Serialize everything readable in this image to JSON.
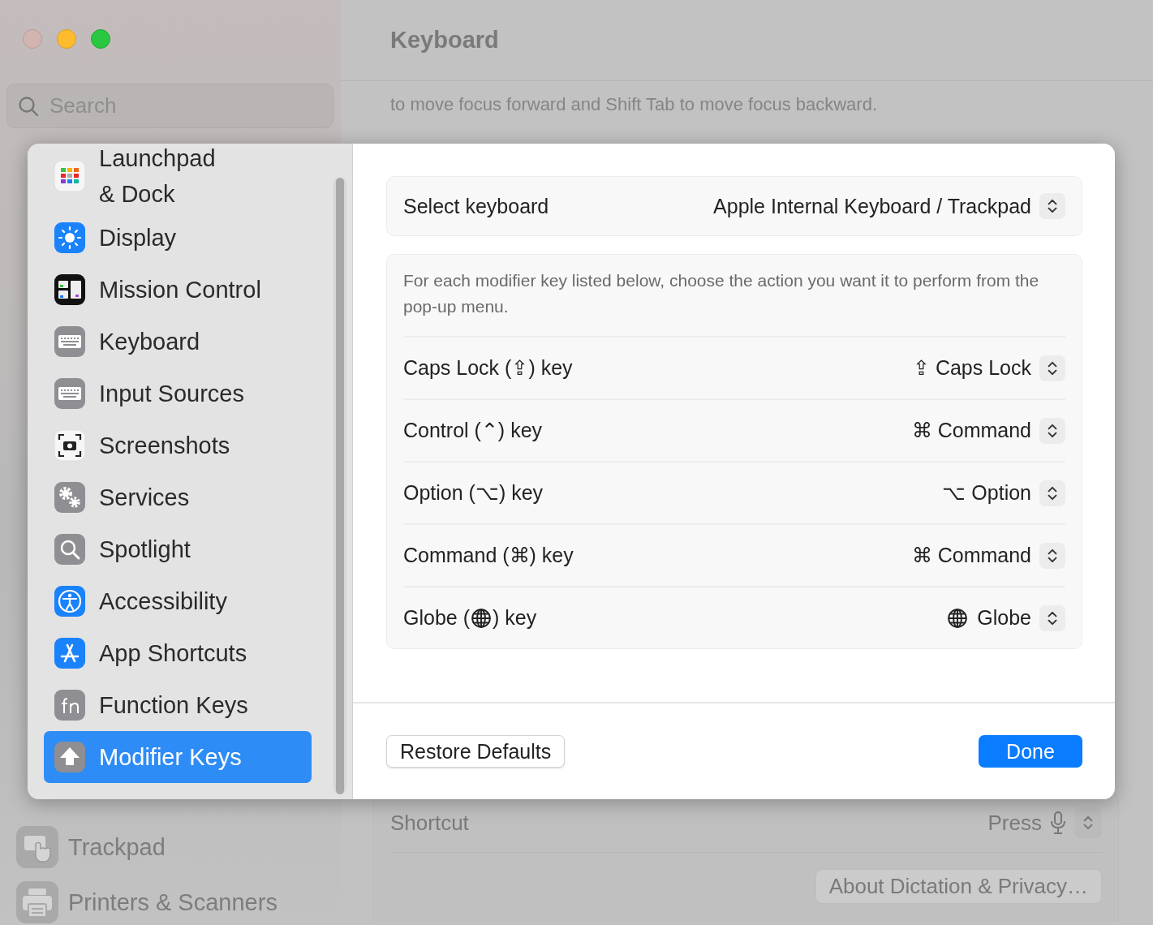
{
  "window": {
    "title": "Keyboard"
  },
  "search": {
    "placeholder": "Search"
  },
  "background_sidebar": {
    "items": [
      {
        "label": "Trackpad"
      },
      {
        "label": "Printers & Scanners"
      }
    ]
  },
  "background_pane": {
    "text": "to move focus forward and Shift Tab to move focus backward.",
    "shortcut": {
      "label": "Shortcut",
      "value": "Press"
    },
    "about_button": "About Dictation & Privacy…"
  },
  "sheet": {
    "sidebar": [
      {
        "label": "Launchpad\n& Dock",
        "selected": false
      },
      {
        "label": "Display",
        "selected": false
      },
      {
        "label": "Mission Control",
        "selected": false
      },
      {
        "label": "Keyboard",
        "selected": false
      },
      {
        "label": "Input Sources",
        "selected": false
      },
      {
        "label": "Screenshots",
        "selected": false
      },
      {
        "label": "Services",
        "selected": false
      },
      {
        "label": "Spotlight",
        "selected": false
      },
      {
        "label": "Accessibility",
        "selected": false
      },
      {
        "label": "App Shortcuts",
        "selected": false
      },
      {
        "label": "Function Keys",
        "selected": false
      },
      {
        "label": "Modifier Keys",
        "selected": true
      }
    ],
    "select_keyboard": {
      "label": "Select keyboard",
      "value": "Apple Internal Keyboard / Trackpad"
    },
    "description": "For each modifier key listed below, choose the action you want it to perform from the pop-up menu.",
    "modifiers": [
      {
        "kind": "glyph",
        "label": "Caps Lock (⇪) key",
        "value": "⇪ Caps Lock"
      },
      {
        "kind": "glyph",
        "label": "Control (⌃) key",
        "value": "⌘ Command"
      },
      {
        "kind": "glyph",
        "label": "Option (⌥) key",
        "value": "⌥ Option"
      },
      {
        "kind": "glyph",
        "label": "Command (⌘) key",
        "value": "⌘ Command"
      },
      {
        "kind": "globe",
        "label_before": "Globe (",
        "label_after": ") key",
        "value": "Globe"
      }
    ],
    "buttons": [
      {
        "kind": "plain",
        "label": "Restore Defaults"
      },
      {
        "kind": "primary",
        "label": "Done"
      }
    ]
  }
}
